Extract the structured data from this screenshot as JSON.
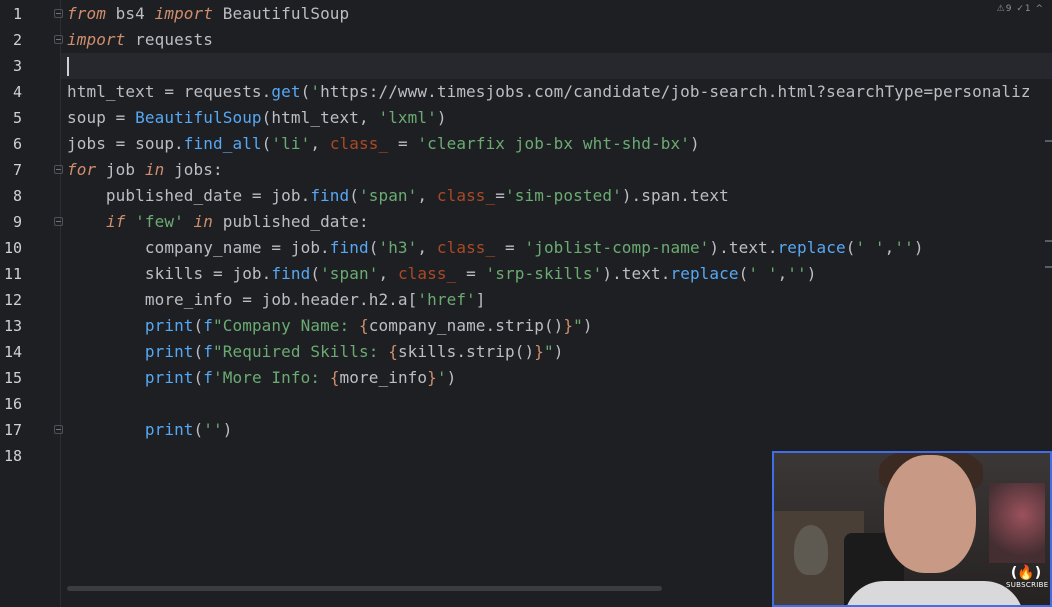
{
  "editor": {
    "inspection_status": "⚠9 ✓1 ^",
    "lines": [
      {
        "number": "1",
        "text": "from bs4 import BeautifulSoup"
      },
      {
        "number": "2",
        "text": "import requests"
      },
      {
        "number": "3",
        "text": ""
      },
      {
        "number": "4",
        "text": "html_text = requests.get('https://www.timesjobs.com/candidate/job-search.html?searchType=personaliz"
      },
      {
        "number": "5",
        "text": "soup = BeautifulSoup(html_text, 'lxml')"
      },
      {
        "number": "6",
        "text": "jobs = soup.find_all('li', class_ = 'clearfix job-bx wht-shd-bx')"
      },
      {
        "number": "7",
        "text": "for job in jobs:"
      },
      {
        "number": "8",
        "text": "    published_date = job.find('span', class_='sim-posted').span.text"
      },
      {
        "number": "9",
        "text": "    if 'few' in published_date:"
      },
      {
        "number": "10",
        "text": "        company_name = job.find('h3', class_ = 'joblist-comp-name').text.replace(' ','')"
      },
      {
        "number": "11",
        "text": "        skills = job.find('span', class_ = 'srp-skills').text.replace(' ','')"
      },
      {
        "number": "12",
        "text": "        more_info = job.header.h2.a['href']"
      },
      {
        "number": "13",
        "text": "        print(f\"Company Name: {company_name.strip()}\")"
      },
      {
        "number": "14",
        "text": "        print(f\"Required Skills: {skills.strip()}\")"
      },
      {
        "number": "15",
        "text": "        print(f'More Info: {more_info}')"
      },
      {
        "number": "16",
        "text": ""
      },
      {
        "number": "17",
        "text": "        print('')"
      },
      {
        "number": "18",
        "text": ""
      }
    ]
  },
  "webcam": {
    "logo_glyph": "(🔥)",
    "logo_text": "SUBSCRIBE"
  },
  "colors": {
    "background": "#1e1f22",
    "keyword": "#cf8e6d",
    "string": "#6aab73",
    "function": "#56a8f5",
    "parameter": "#aa4926",
    "webcam_border": "#3f6ee8"
  }
}
